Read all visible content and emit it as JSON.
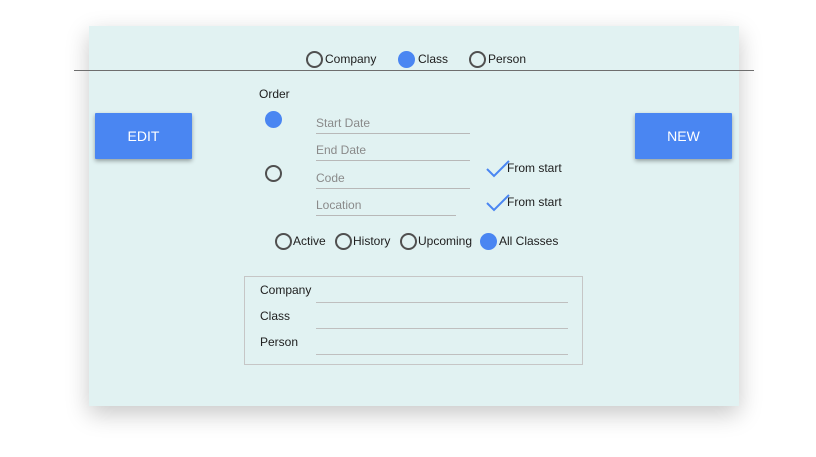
{
  "colors": {
    "panel_bg": "#e1f2f2",
    "accent": "#4a86f2"
  },
  "top_filter": {
    "options": [
      {
        "label": "Company",
        "selected": false
      },
      {
        "label": "Class",
        "selected": true
      },
      {
        "label": "Person",
        "selected": false
      }
    ]
  },
  "buttons": {
    "edit": "EDIT",
    "new": "NEW"
  },
  "order": {
    "title": "Order",
    "fields": {
      "start_date": "Start Date",
      "end_date": "End Date",
      "code": "Code",
      "location": "Location"
    },
    "from_start_label": "From start",
    "code_from_start_checked": true,
    "location_from_start_checked": true,
    "date_order_selected": true,
    "code_order_selected": false
  },
  "status_filter": {
    "options": [
      {
        "label": "Active",
        "selected": false
      },
      {
        "label": "History",
        "selected": false
      },
      {
        "label": "Upcoming",
        "selected": false
      },
      {
        "label": "All Classes",
        "selected": true
      }
    ]
  },
  "search_box": {
    "company_label": "Company",
    "class_label": "Class",
    "person_label": "Person",
    "company_value": "",
    "class_value": "",
    "person_value": ""
  }
}
